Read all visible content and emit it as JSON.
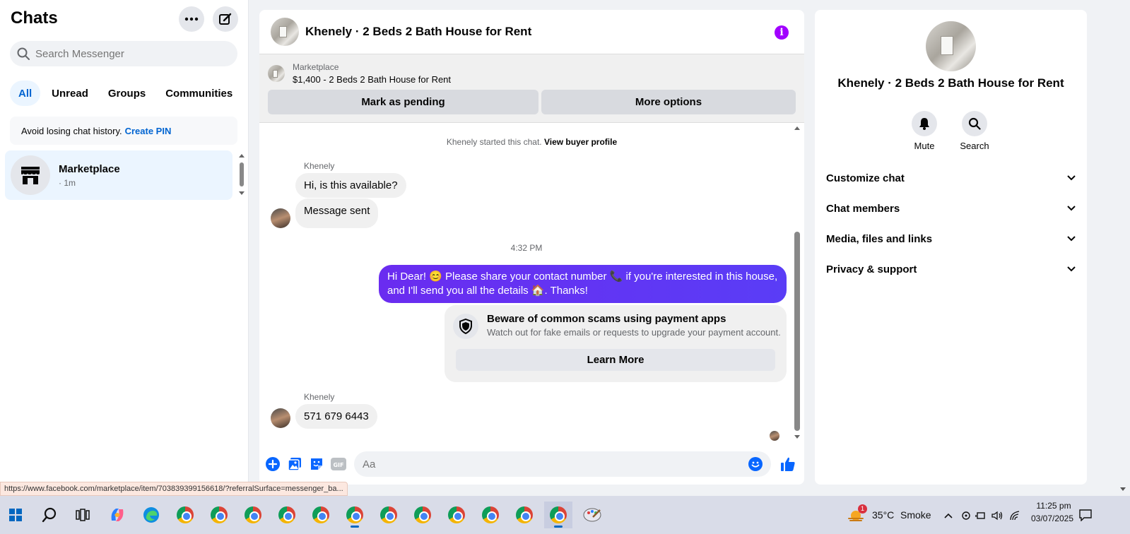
{
  "sidebar": {
    "title": "Chats",
    "search_placeholder": "Search Messenger",
    "filters": [
      "All",
      "Unread",
      "Groups",
      "Communities"
    ],
    "pin_banner": {
      "text": "Avoid losing chat history.",
      "link": "Create PIN"
    },
    "chat_item": {
      "name": "Marketplace",
      "time": "· 1m"
    }
  },
  "chat": {
    "title": "Khenely · 2 Beds 2 Bath House for Rent",
    "listing": {
      "source": "Marketplace",
      "price_title": "$1,400 - 2 Beds 2 Bath House for Rent",
      "mark_pending_label": "Mark as pending",
      "more_options_label": "More options"
    },
    "started_text": "Khenely started this chat.",
    "view_profile_link": "View buyer profile",
    "messages": {
      "sender1": "Khenely",
      "msg1": "Hi, is this available?",
      "msg2": "Message sent",
      "timestamp": "4:32 PM",
      "outgoing": "Hi Dear! 😊 Please share your contact number 📞 if you're interested in this house, and I'll send you all the details 🏠. Thanks!",
      "sender2": "Khenely",
      "msg3": "571 679 6443"
    },
    "scam_card": {
      "title": "Beware of common scams using payment apps",
      "body": "Watch out for fake emails or requests to upgrade your payment account.",
      "button": "Learn More"
    },
    "composer": {
      "placeholder": "Aa"
    }
  },
  "info_panel": {
    "name": "Khenely · 2 Beds 2 Bath House for Rent",
    "actions": [
      "Mute",
      "Search"
    ],
    "sections": [
      "Customize chat",
      "Chat members",
      "Media, files and links",
      "Privacy & support"
    ]
  },
  "status_url": "https://www.facebook.com/marketplace/item/703839399156618/?referralSurface=messenger_ba...",
  "taskbar": {
    "weather_temp": "35°C",
    "weather_desc": "Smoke",
    "weather_badge": "1",
    "time": "11:25 pm",
    "date": "03/07/2025"
  },
  "colors": {
    "accent_blue": "#0064d1",
    "outgoing_bubble": "#5b34f5",
    "info_purple": "#a100ff",
    "thumb_blue": "#0866ff"
  }
}
